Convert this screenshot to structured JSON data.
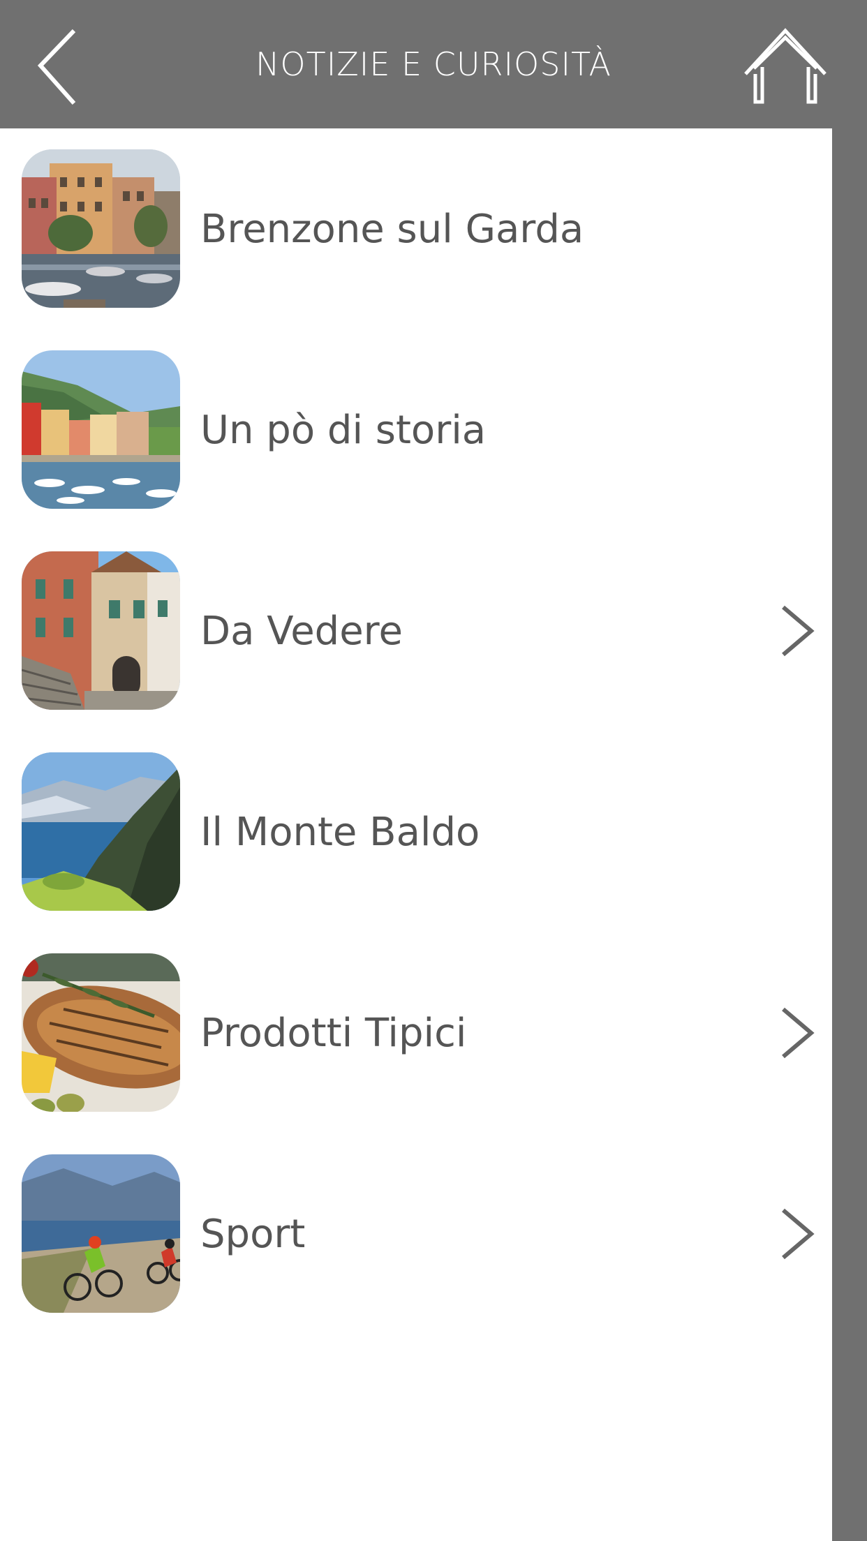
{
  "header": {
    "title": "NOTIZIE E CURIOSITÀ",
    "background": "#707070"
  },
  "items": [
    {
      "label": "Brenzone sul Garda",
      "has_chevron": false,
      "thumb": "lakeside-town-photo"
    },
    {
      "label": "Un pò di storia",
      "has_chevron": false,
      "thumb": "harbor-village-photo"
    },
    {
      "label": "Da Vedere",
      "has_chevron": true,
      "thumb": "village-street-photo"
    },
    {
      "label": "Il Monte Baldo",
      "has_chevron": false,
      "thumb": "mountain-lake-photo"
    },
    {
      "label": "Prodotti Tipici",
      "has_chevron": true,
      "thumb": "grilled-fish-photo"
    },
    {
      "label": "Sport",
      "has_chevron": true,
      "thumb": "mountain-bikers-photo"
    }
  ],
  "colors": {
    "text": "#555555",
    "list_bg": "#ffffff",
    "chrome": "#707070"
  }
}
